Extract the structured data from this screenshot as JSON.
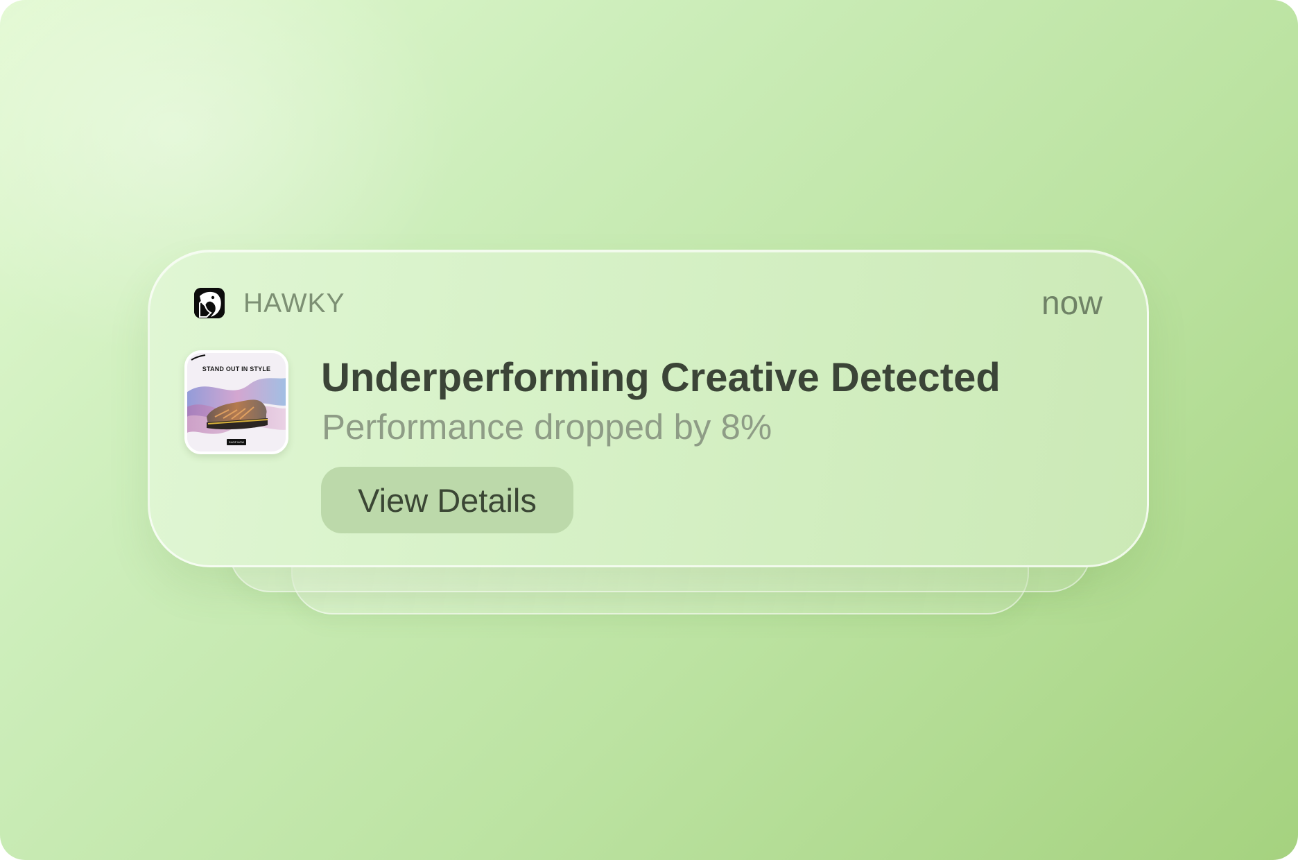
{
  "notification": {
    "app_name": "HAWKY",
    "app_icon": "eagle-head-icon",
    "timestamp": "now",
    "title": "Underperforming Creative Detected",
    "subtitle": "Performance dropped by 8%",
    "action_label": "View Details",
    "thumbnail": {
      "headline": "STAND OUT IN STYLE",
      "cta": "SHOP NOW",
      "subject": "sneaker"
    }
  },
  "colors": {
    "background_start": "#e2f9d2",
    "background_end": "#a5d27f",
    "card": "#d8f2c9",
    "button": "#bcd9aa",
    "title_text": "#3b4437",
    "secondary_text": "#8e9c86"
  }
}
